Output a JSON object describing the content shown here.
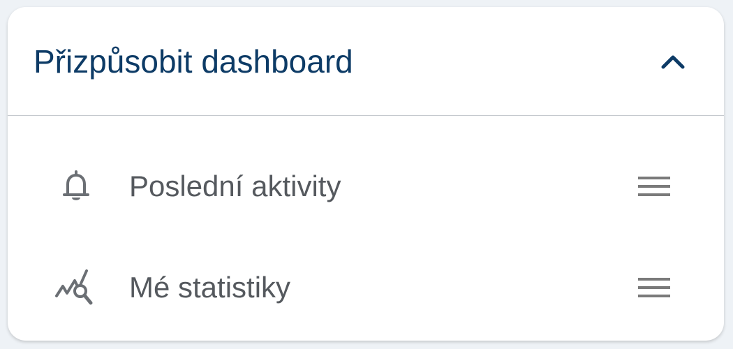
{
  "card": {
    "title": "Přizpůsobit dashboard",
    "collapse_icon": "chevron-up-icon"
  },
  "widgets": [
    {
      "label": "Poslední aktivity",
      "icon": "bell-icon",
      "handle_icon": "drag-handle-icon"
    },
    {
      "label": "Mé statistiky",
      "icon": "statistics-search-icon",
      "handle_icon": "drag-handle-icon"
    }
  ],
  "colors": {
    "title": "#0d3b66",
    "label": "#55595e",
    "icon": "#6b6f74",
    "handle": "#7a7a7a",
    "divider": "#c5c9ce",
    "background": "#eef2f6",
    "card": "#ffffff"
  }
}
